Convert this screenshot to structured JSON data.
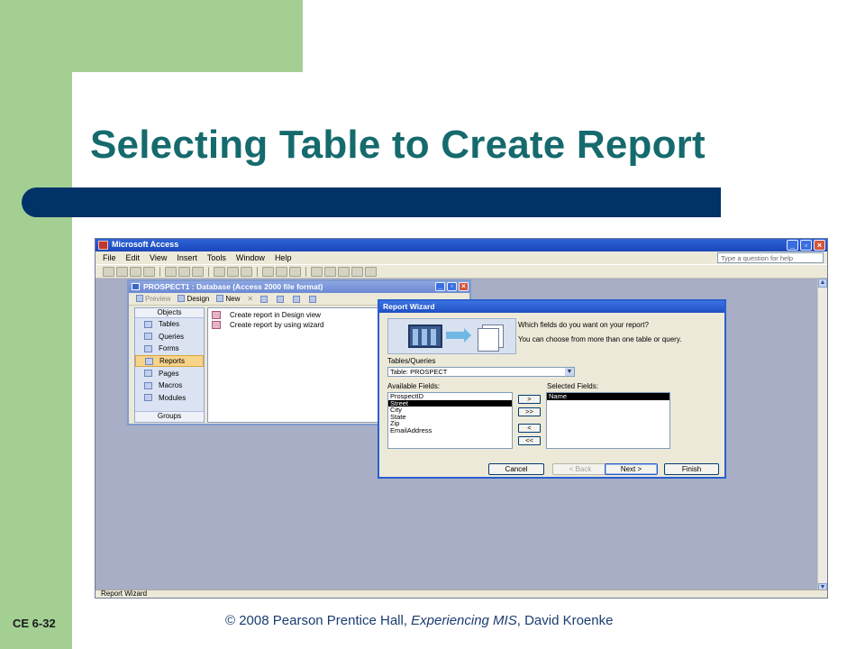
{
  "slide": {
    "title": "Selecting Table to Create Report",
    "slide_number": "CE 6-32",
    "footer_prefix": "© 2008 Pearson Prentice Hall, ",
    "footer_book": "Experiencing MIS",
    "footer_suffix": ", David Kroenke"
  },
  "access": {
    "title": "Microsoft Access",
    "menu": [
      "File",
      "Edit",
      "View",
      "Insert",
      "Tools",
      "Window",
      "Help"
    ],
    "help_placeholder": "Type a question for help",
    "status": "Report Wizard"
  },
  "db_window": {
    "title": "PROSPECT1 : Database (Access 2000 file format)",
    "toolbar": {
      "preview": "Preview",
      "design": "Design",
      "new": "New"
    },
    "objects_header": "Objects",
    "objects": [
      "Tables",
      "Queries",
      "Forms",
      "Reports",
      "Pages",
      "Macros",
      "Modules"
    ],
    "selected_object": "Reports",
    "groups_label": "Groups",
    "list_items": [
      "Create report in Design view",
      "Create report by using wizard"
    ]
  },
  "wizard": {
    "title": "Report Wizard",
    "question": "Which fields do you want on your report?",
    "hint": "You can choose from more than one table or query.",
    "tables_label": "Tables/Queries",
    "table_value": "Table: PROSPECT",
    "available_label": "Available Fields:",
    "selected_label": "Selected Fields:",
    "available_fields": [
      "ProspectID",
      "Street",
      "City",
      "State",
      "Zip",
      "EmailAddress"
    ],
    "highlighted_available": "Street",
    "selected_fields": [
      "Name"
    ],
    "move_buttons": [
      ">",
      ">>",
      "<",
      "<<"
    ],
    "buttons": {
      "cancel": "Cancel",
      "back": "< Back",
      "next": "Next >",
      "finish": "Finish"
    }
  }
}
